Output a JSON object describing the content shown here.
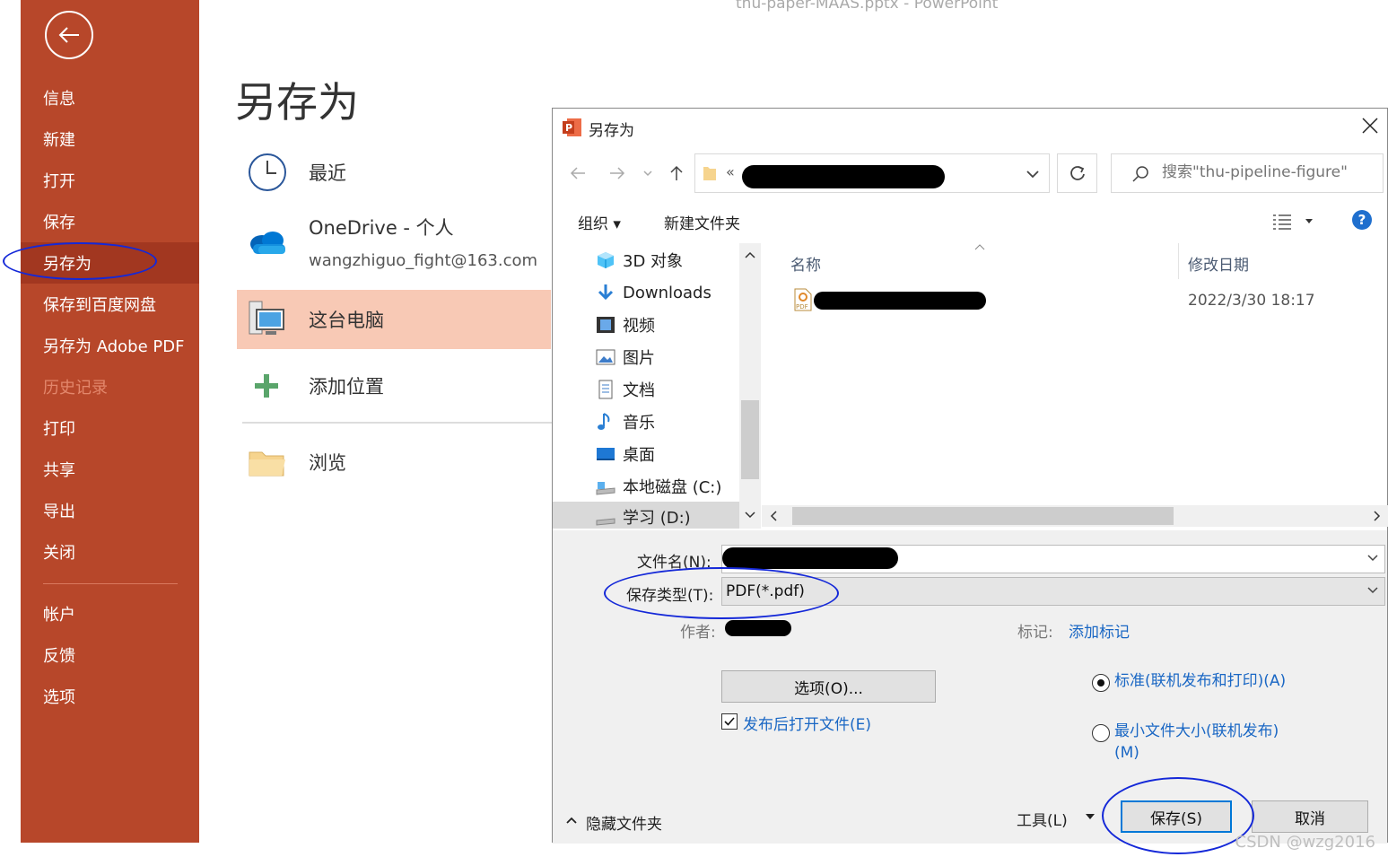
{
  "window": {
    "title": "thu-paper-MAAS.pptx  -  PowerPoint"
  },
  "sidebar": {
    "items": [
      {
        "label": "信息"
      },
      {
        "label": "新建"
      },
      {
        "label": "打开"
      },
      {
        "label": "保存"
      },
      {
        "label": "另存为",
        "active": true
      },
      {
        "label": "保存到百度网盘"
      },
      {
        "label": "另存为 Adobe PDF"
      },
      {
        "label": "历史记录",
        "disabled": true
      },
      {
        "label": "打印"
      },
      {
        "label": "共享"
      },
      {
        "label": "导出"
      },
      {
        "label": "关闭"
      },
      {
        "label": "帐户"
      },
      {
        "label": "反馈"
      },
      {
        "label": "选项"
      }
    ]
  },
  "backstage": {
    "title": "另存为",
    "locations": [
      {
        "label": "最近",
        "icon": "clock-icon"
      },
      {
        "label": "OneDrive - 个人",
        "sub": "wangzhiguo_fight@163.com",
        "icon": "onedrive-cloud-icon"
      },
      {
        "label": "这台电脑",
        "icon": "computer-icon",
        "active": true
      },
      {
        "label": "添加位置",
        "icon": "add-plus-icon"
      },
      {
        "label": "浏览",
        "icon": "folder-icon"
      }
    ]
  },
  "dialog": {
    "title": "另存为",
    "address_prefix": "«",
    "search_placeholder": "搜索\"thu-pipeline-figure\"",
    "toolbar": {
      "organize": "组织 ▾",
      "new_folder": "新建文件夹"
    },
    "tree": [
      {
        "label": "3D 对象",
        "icon": "3d-objects-icon"
      },
      {
        "label": "Downloads",
        "icon": "download-icon"
      },
      {
        "label": "视频",
        "icon": "video-icon"
      },
      {
        "label": "图片",
        "icon": "pictures-icon"
      },
      {
        "label": "文档",
        "icon": "documents-icon"
      },
      {
        "label": "音乐",
        "icon": "music-icon"
      },
      {
        "label": "桌面",
        "icon": "desktop-icon"
      },
      {
        "label": "本地磁盘 (C:)",
        "icon": "drive-icon"
      },
      {
        "label": "学习 (D:)",
        "icon": "drive-icon",
        "selected": true
      }
    ],
    "columns": {
      "name": "名称",
      "modified": "修改日期"
    },
    "files": [
      {
        "modified": "2022/3/30 18:17",
        "icon": "pdf-file-icon"
      }
    ],
    "form": {
      "filename_label": "文件名(N):",
      "type_label": "保存类型(T):",
      "type_value": "PDF(*.pdf)",
      "author_label": "作者:",
      "tags_label": "标记:",
      "tags_link": "添加标记",
      "options_button": "选项(O)...",
      "open_after_publish": "发布后打开文件(E)",
      "open_after_publish_checked": true,
      "optimize_standard": "标准(联机发布和打印)(A)",
      "optimize_min": "最小文件大小(联机发布)(M)",
      "hide_folders": "隐藏文件夹",
      "tools": "工具(L)",
      "save": "保存(S)",
      "cancel": "取消"
    }
  },
  "watermark": "CSDN @wzg2016",
  "colors": {
    "accent": "#b7472a",
    "active": "#a23720",
    "location_active": "#f8c9b5",
    "link": "#1a67c4",
    "annotation": "#1428d8"
  }
}
